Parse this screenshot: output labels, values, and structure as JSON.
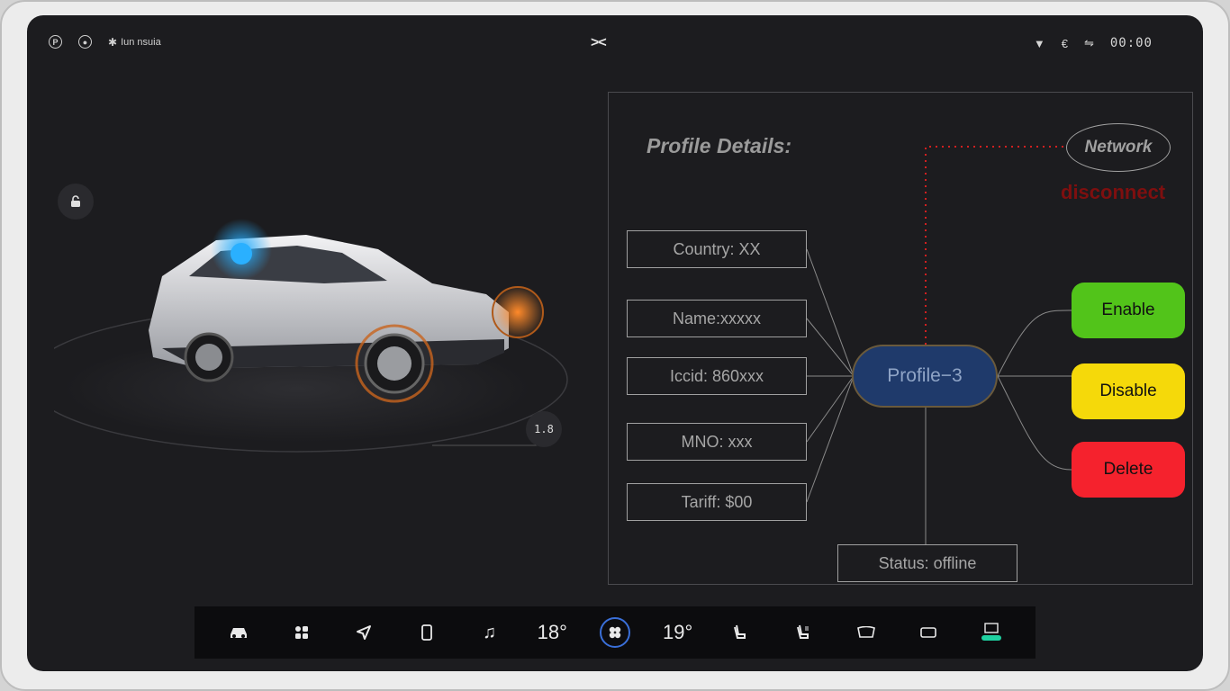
{
  "status_bar": {
    "left_text": "Iun nsuia",
    "center_logo": "><",
    "time": "00:00",
    "icons": [
      "parking-icon",
      "steering-icon",
      "bluetooth-icon",
      "wifi-icon",
      "signal-icon",
      "usb-icon"
    ]
  },
  "car_view": {
    "lock_icon": "lock-icon",
    "value_badge": "1.8"
  },
  "profile": {
    "title": "Profile Details:",
    "details": [
      {
        "label": "Country: XX"
      },
      {
        "label": "Name:xxxxx"
      },
      {
        "label": "Iccid: 860xxx"
      },
      {
        "label": "MNO: xxx"
      },
      {
        "label": "Tariff: $00"
      }
    ],
    "node": "Profile−3",
    "status": "Status: offline",
    "network": "Network",
    "network_state": "disconnect",
    "actions": {
      "enable": "Enable",
      "disable": "Disable",
      "delete": "Delete"
    },
    "colors": {
      "enable": "#52c41a",
      "disable": "#f5d90a",
      "delete": "#f5222d",
      "disconnect": "#7e0f0f",
      "node": "#1f3a6b"
    }
  },
  "dock": {
    "temp_left": "18°",
    "temp_right": "19°",
    "icons": [
      "car-icon",
      "apps-icon",
      "navigation-icon",
      "phone-icon",
      "music-icon",
      "fan-icon",
      "seat-heat-left-icon",
      "seat-heat-right-icon",
      "front-defrost-icon",
      "rear-defrost-icon",
      "auto-climate-icon"
    ]
  }
}
